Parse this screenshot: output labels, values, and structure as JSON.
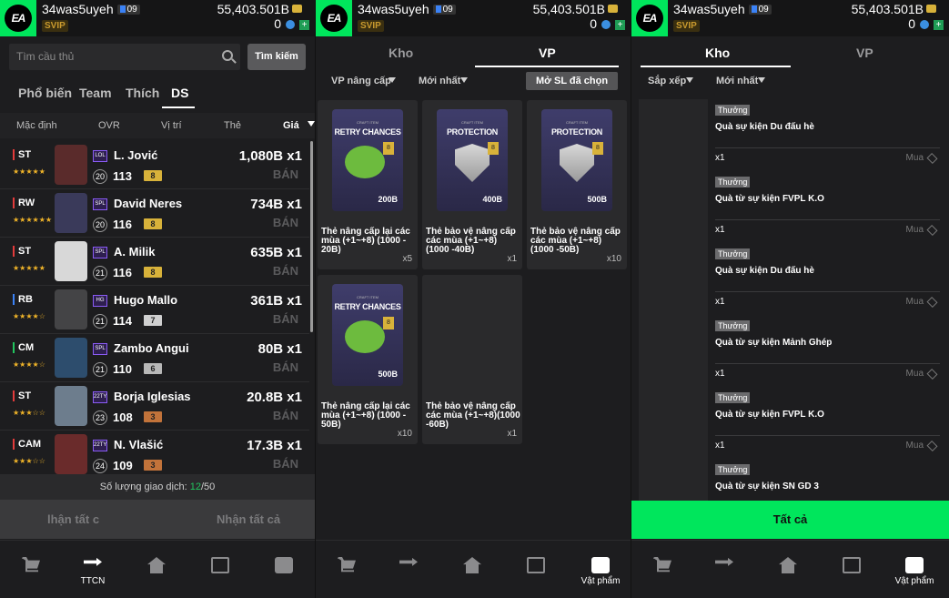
{
  "header": {
    "username": "34was5uyeh",
    "level": "09",
    "vip": "SVIP",
    "coins": "55,403.501B",
    "points": "0",
    "plus": "+"
  },
  "panel1": {
    "search": {
      "placeholder": "Tìm cầu thủ",
      "button": "Tìm kiếm"
    },
    "tabs": [
      "Phổ biến",
      "Team",
      "Thích",
      "DS"
    ],
    "sort": [
      "Mặc định",
      "OVR",
      "Vị trí",
      "Thẻ",
      "Giá"
    ],
    "players": [
      {
        "pos": "ST",
        "club": "LOL",
        "name": "L. Jović",
        "ovr_circle": "20",
        "ovr": "113",
        "up": "8",
        "price": "1,080B x1",
        "sell": "BÁN"
      },
      {
        "pos": "RW",
        "club": "SPL",
        "name": "David Neres",
        "ovr_circle": "20",
        "ovr": "116",
        "up": "8",
        "price": "734B x1",
        "sell": "BÁN"
      },
      {
        "pos": "ST",
        "club": "SPL",
        "name": "A. Milik",
        "ovr_circle": "21",
        "ovr": "116",
        "up": "8",
        "price": "635B x1",
        "sell": "BÁN"
      },
      {
        "pos": "RB",
        "club": "HG",
        "name": "Hugo Mallo",
        "ovr_circle": "21",
        "ovr": "114",
        "up": "7",
        "price": "361B x1",
        "sell": "BÁN"
      },
      {
        "pos": "CM",
        "club": "SPL",
        "name": "Zambo Angui",
        "ovr_circle": "21",
        "ovr": "110",
        "up": "6",
        "price": "80B x1",
        "sell": "BÁN"
      },
      {
        "pos": "ST",
        "club": "22TY",
        "name": "Borja Iglesias",
        "ovr_circle": "23",
        "ovr": "108",
        "up": "3",
        "price": "20.8B x1",
        "sell": "BÁN"
      },
      {
        "pos": "CAM",
        "club": "22TY",
        "name": "N. Vlašić",
        "ovr_circle": "24",
        "ovr": "109",
        "up": "3",
        "price": "17.3B x1",
        "sell": "BÁN"
      }
    ],
    "trade_label": "Số lượng giao dịch: ",
    "trade_used": "12",
    "trade_total": "/50",
    "recv_left": "lhận tất c",
    "recv_right": "Nhận tất cả"
  },
  "panel2": {
    "tabs": [
      "Kho",
      "VP"
    ],
    "filters": [
      "VP nâng cấp",
      "Mới nhất"
    ],
    "open_btn": "Mở SL đã chọn",
    "cards": [
      {
        "title": "RETRY CHANCES",
        "sub": "CRAFT ITEM",
        "tag": "8",
        "val": "200B",
        "desc": "Thẻ nâng cấp lại các mùa (+1~+8) (1000 - 20B)",
        "qty": "x5"
      },
      {
        "title": "PROTECTION",
        "sub": "CRAFT ITEM",
        "tag": "8",
        "val": "400B",
        "desc": "Thẻ bảo vệ nâng cấp các mùa (+1~+8) (1000 -40B)",
        "qty": "x1"
      },
      {
        "title": "PROTECTION",
        "sub": "CRAFT ITEM",
        "tag": "8",
        "val": "500B",
        "desc": "Thẻ bảo vệ nâng cấp các mùa (+1~+8) (1000 -50B)",
        "qty": "x10"
      },
      {
        "title": "RETRY CHANCES",
        "sub": "CRAFT ITEM",
        "tag": "8",
        "val": "500B",
        "desc": "Thẻ nâng cấp lại các mùa (+1~+8) (1000 - 50B)",
        "qty": "x10"
      },
      {
        "title": "",
        "sub": "",
        "tag": "",
        "val": "",
        "desc": "Thẻ bảo vệ nâng cấp các mùa (+1~+8)(1000 -60B)",
        "qty": "x1"
      }
    ]
  },
  "panel3": {
    "tabs": [
      "Kho",
      "VP"
    ],
    "filters": [
      "Sắp xếp",
      "Mới nhất"
    ],
    "items": [
      {
        "badge": "Thưởng",
        "title": "Quà sự kiện Du đấu hè",
        "qty": "x1",
        "buy": "Mua"
      },
      {
        "badge": "Thưởng",
        "title": "Quà từ sự kiện FVPL K.O",
        "qty": "x1",
        "buy": "Mua"
      },
      {
        "badge": "Thưởng",
        "title": "Quà sự kiện Du đấu hè",
        "qty": "x1",
        "buy": "Mua"
      },
      {
        "badge": "Thưởng",
        "title": "Quà từ sự kiện Mảnh Ghép",
        "qty": "x1",
        "buy": "Mua"
      },
      {
        "badge": "Thưởng",
        "title": "Quà từ sự kiện FVPL K.O",
        "qty": "x1",
        "buy": "Mua"
      },
      {
        "badge": "Thưởng",
        "title": "Quà từ sự kiện SN GD 3",
        "qty": "",
        "buy": ""
      }
    ],
    "all_btn": "Tất cả"
  },
  "nav": {
    "ttcn": "TTCN",
    "items": "Vật phẩm"
  },
  "colors": {
    "accent": "#00e65c",
    "dark": "#1d1d1f",
    "gold": "#d8b23a"
  }
}
